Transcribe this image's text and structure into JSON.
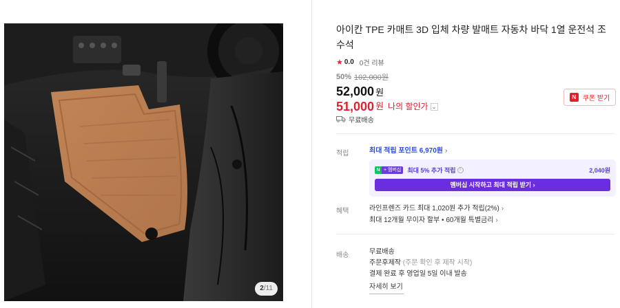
{
  "gallery": {
    "counter_current": "2",
    "counter_total": "/11"
  },
  "product": {
    "title": "아이칸 TPE 카매트 3D 입체 차량 발매트 자동차 바닥 1열 운전석 조수석",
    "rating": "0.0",
    "review_count": "0건 리뷰"
  },
  "price": {
    "discount_rate": "50%",
    "original": "102,000원",
    "sale_amount": "52,000",
    "sale_unit": "원",
    "my_amount": "51,000",
    "my_unit": "원",
    "my_label": "나의 할인가",
    "my_chevron": "⌄"
  },
  "coupon": {
    "badge": "N",
    "label": "쿠폰 받기"
  },
  "shipping_summary": {
    "icon": "truck-icon",
    "text": "무료배송"
  },
  "points": {
    "section_label": "적립",
    "max_points": "최대 적립 포인트 6,970원",
    "arrow": "›",
    "member": {
      "badge_n": "N",
      "badge_plus": "+ 멤버십",
      "text": "최대 5% 추가 적립",
      "info": "i",
      "amount": "2,040원",
      "button": "멤버십 시작하고 최대 적립 받기 ›"
    }
  },
  "benefits": {
    "section_label": "혜택",
    "card": "라인프렌즈 카드 최대 1,020원 추가 적립(2%)",
    "installment": "최대 12개월 무이자 할부 • 60개월 특별금리",
    "arrow": "›"
  },
  "delivery": {
    "section_label": "배송",
    "free": "무료배송",
    "made_to_order": "주문후제작",
    "made_to_order_note": "(주문 확인 후 제작 시작)",
    "dispatch": "결제 완료 후 영업일 5일 이내 발송",
    "detail_button": "자세히 보기"
  },
  "colors": {
    "accent_red": "#e0202e",
    "point_blue": "#2a4ad8",
    "membership_purple": "#6a2de0",
    "mat_tan": "#c8895a"
  }
}
